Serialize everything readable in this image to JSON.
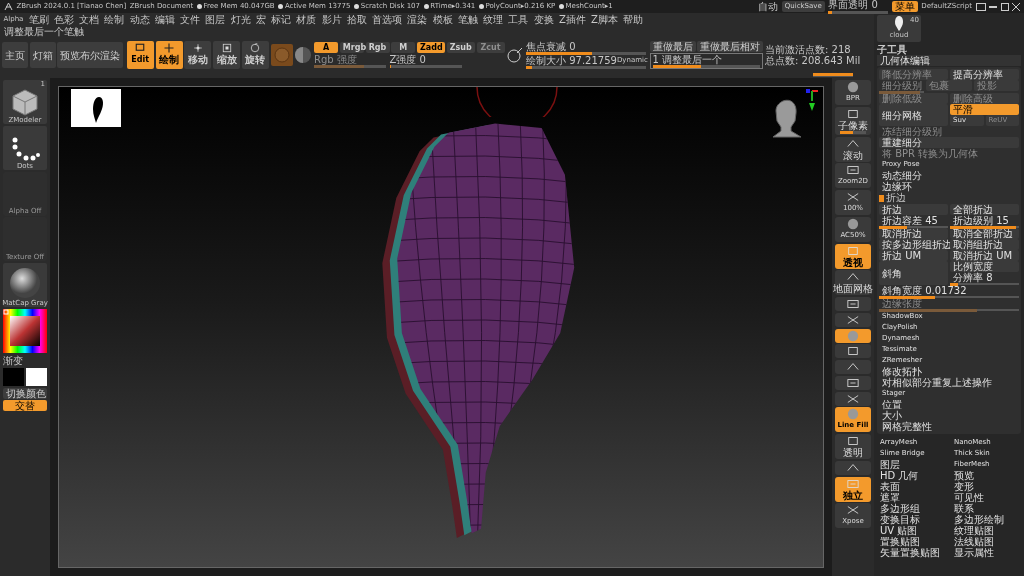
{
  "title_bar": {
    "app": "ZBrush 2024.0.1 [Tianao Chen]",
    "document": "ZBrush Document",
    "stats": [
      "Free Mem 40.047GB",
      "Active Mem 13775",
      "Scratch Disk 107",
      "RTime▸0.341",
      "PolyCount▸0.216 KP",
      "MeshCount▸1"
    ]
  },
  "top_right": {
    "autosave": "自动",
    "quicksave": "QuickSave",
    "transparency": {
      "label": "界面透明 0",
      "level": 0.06
    },
    "menu_button": "菜单",
    "script": "DefaultZScript"
  },
  "menu": [
    "Alpha",
    "笔刷",
    "色彩",
    "文档",
    "绘制",
    "动态",
    "编辑",
    "文件",
    "图层",
    "灯光",
    "宏",
    "标记",
    "材质",
    "影片",
    "拾取",
    "首选项",
    "渲染",
    "模板",
    "笔触",
    "纹理",
    "工具",
    "变换",
    "Z插件",
    "Z脚本",
    "帮助"
  ],
  "hint": "调整最后一个笔触",
  "toolbar": {
    "buttons": [
      "主页",
      "灯箱",
      "预览布尔渲染"
    ],
    "modes": [
      {
        "label": "Edit",
        "selected": true
      },
      {
        "label": "绘制",
        "selected": true
      },
      {
        "label": "移动",
        "selected": false
      },
      {
        "label": "缩放",
        "selected": false
      },
      {
        "label": "旋转",
        "selected": false
      }
    ],
    "channels": [
      {
        "label": "A",
        "selected": true
      },
      {
        "label": "Mrgb",
        "selected": false
      },
      {
        "label": "Rgb",
        "selected": false
      },
      {
        "label": "M",
        "selected": false
      }
    ],
    "z_modes": [
      {
        "label": "Zadd",
        "selected": true,
        "disabled": false
      },
      {
        "label": "Zsub",
        "selected": false,
        "disabled": false
      },
      {
        "label": "Zcut",
        "selected": false,
        "disabled": true
      }
    ],
    "intensity": [
      {
        "label": "Rgb 强度",
        "level": 0.7,
        "disabled": true
      },
      {
        "label": "Z强度 0",
        "level": 0.02,
        "disabled": false
      }
    ],
    "brush_sliders": [
      {
        "label": "焦点衰减 0",
        "level": 0.55
      },
      {
        "label": "绘制大小 97.21759",
        "level": 0.05
      }
    ],
    "dynamic": "Dynamic",
    "redo": [
      "重做最后",
      "重做最后相对"
    ],
    "last_stroke": {
      "value": "1 调整最后一个",
      "level": 0.45
    },
    "active_points": "当前激活点数: 218",
    "total_points": "总点数: 208.643 Mil"
  },
  "left_shelf": [
    {
      "kind": "tool",
      "label": "ZModeler",
      "badge": "1"
    },
    {
      "kind": "brush",
      "label": "Dots"
    },
    {
      "kind": "empty",
      "label": "Alpha Off"
    },
    {
      "kind": "empty",
      "label": "Texture Off"
    },
    {
      "kind": "material",
      "label": "MatCap Gray"
    }
  ],
  "color": {
    "gradient": "渐变",
    "switch": "切换颜色",
    "alternate": "交替"
  },
  "right_shelf": [
    {
      "label": "BPR",
      "selected": false
    },
    {
      "label": "子像素",
      "selected": false,
      "level": 0.5
    },
    {
      "label": "滚动",
      "selected": false
    },
    {
      "label": "Zoom2D",
      "selected": false
    },
    {
      "label": "100%",
      "selected": false
    },
    {
      "label": "AC50%",
      "selected": false
    },
    {
      "label": "透视",
      "selected": true
    },
    {
      "label": "地面网格",
      "selected": false
    },
    {
      "selected": false
    },
    {
      "selected": false
    },
    {
      "selected": true
    },
    {
      "selected": false
    },
    {
      "selected": false
    },
    {
      "selected": false
    },
    {
      "selected": false
    },
    {
      "label": "Line Fill",
      "selected": true
    },
    {
      "label": "透明",
      "selected": false
    },
    {
      "selected": false
    },
    {
      "label": "独立",
      "selected": true
    },
    {
      "label": "Xpose",
      "selected": false
    }
  ],
  "tool_panel": {
    "thumb": {
      "label": "cloud",
      "count": "40"
    },
    "subtool": "子工具",
    "section": "几何体编辑",
    "rows": [
      {
        "cells": [
          {
            "kind": "button",
            "label": "降低分辨率",
            "disabled": true
          },
          {
            "kind": "button",
            "label": "提高分辨率",
            "disabled": false
          }
        ]
      },
      {
        "cells": [
          {
            "kind": "slider",
            "label": "细分级别",
            "level": 0.9,
            "disabled": true
          },
          {
            "kind": "button",
            "label": "包裹",
            "disabled": true
          },
          {
            "kind": "button",
            "label": "投影",
            "disabled": true
          }
        ]
      },
      {
        "cells": [
          {
            "kind": "button",
            "label": "删除低级",
            "disabled": true
          },
          {
            "kind": "button",
            "label": "删除高级",
            "disabled": true
          }
        ]
      },
      {
        "cells": [
          {
            "kind": "button",
            "label": "细分网格",
            "disabled": false
          },
          {
            "kind": "group",
            "rows": [
              {
                "cells": [
                  {
                    "kind": "toggle",
                    "label": "平滑",
                    "on": true,
                    "disabled": false
                  }
                ]
              },
              {
                "cells": [
                  {
                    "kind": "toggle",
                    "label": "Suv",
                    "on": false,
                    "disabled": false
                  },
                  {
                    "kind": "toggle",
                    "label": "ReUV",
                    "on": false,
                    "disabled": true
                  }
                ]
              }
            ]
          }
        ]
      },
      {
        "cells": [
          {
            "kind": "text",
            "label": "冻结细分级别",
            "disabled": true
          }
        ]
      },
      {
        "cells": [
          {
            "kind": "button",
            "label": "重建细分",
            "disabled": false
          }
        ]
      },
      {
        "cells": [
          {
            "kind": "text",
            "label": "将 BPR 转换为几何体",
            "disabled": true
          }
        ]
      },
      {
        "cells": [
          {
            "kind": "text",
            "label": "Proxy Pose",
            "disabled": false
          }
        ]
      },
      {
        "cells": [
          {
            "kind": "text",
            "label": "动态细分",
            "disabled": false
          }
        ]
      },
      {
        "cells": [
          {
            "kind": "text",
            "label": "边缘环",
            "disabled": false
          }
        ]
      },
      {
        "cells": [
          {
            "kind": "section",
            "label": "折边",
            "expanded": true
          }
        ]
      },
      {
        "cells": [
          {
            "kind": "button",
            "label": "折边",
            "disabled": false
          },
          {
            "kind": "button",
            "label": "全部折边",
            "disabled": false
          }
        ]
      },
      {
        "cells": [
          {
            "kind": "slider",
            "label": "折边容差 45",
            "level": 0.4,
            "disabled": false
          },
          {
            "kind": "slider",
            "label": "折边级别 15",
            "level": 0.95,
            "disabled": false
          }
        ]
      },
      {
        "cells": [
          {
            "kind": "button",
            "label": "取消折边",
            "disabled": false
          },
          {
            "kind": "button",
            "label": "取消全部折边",
            "disabled": false
          }
        ]
      },
      {
        "cells": [
          {
            "kind": "button",
            "label": "按多边形组折边",
            "disabled": false
          },
          {
            "kind": "button",
            "label": "取消组折边",
            "disabled": false
          }
        ]
      },
      {
        "cells": [
          {
            "kind": "button",
            "label": "折边 UM",
            "disabled": false
          },
          {
            "kind": "button",
            "label": "取消折边 UM",
            "disabled": false
          }
        ]
      },
      {
        "cells": [
          {
            "kind": "button",
            "label": "斜角",
            "disabled": false
          },
          {
            "kind": "group",
            "rows": [
              {
                "cells": [
                  {
                    "kind": "button",
                    "label": "比例宽度",
                    "disabled": false
                  }
                ]
              },
              {
                "cells": [
                  {
                    "kind": "slider",
                    "label": "分辨率 8",
                    "level": 0.12,
                    "disabled": false
                  }
                ]
              }
            ]
          }
        ]
      },
      {
        "cells": [
          {
            "kind": "slider",
            "label": "斜角宽度 0.01732",
            "level": 0.4,
            "disabled": false
          }
        ]
      },
      {
        "cells": [
          {
            "kind": "slider",
            "label": "边缘张度",
            "level": 0.7,
            "disabled": true
          }
        ]
      },
      {
        "cells": [
          {
            "kind": "text",
            "label": "ShadowBox",
            "disabled": false
          }
        ]
      },
      {
        "cells": [
          {
            "kind": "text",
            "label": "ClayPolish",
            "disabled": false
          }
        ]
      },
      {
        "cells": [
          {
            "kind": "text",
            "label": "Dynamesh",
            "disabled": false
          }
        ]
      },
      {
        "cells": [
          {
            "kind": "text",
            "label": "Tessimate",
            "disabled": false
          }
        ]
      },
      {
        "cells": [
          {
            "kind": "text",
            "label": "ZRemesher",
            "disabled": false
          }
        ]
      },
      {
        "cells": [
          {
            "kind": "text",
            "label": "修改拓扑",
            "disabled": false
          }
        ]
      },
      {
        "cells": [
          {
            "kind": "text",
            "label": "对相似部分重复上述操作",
            "disabled": false
          }
        ]
      },
      {
        "cells": [
          {
            "kind": "text",
            "label": "Stager",
            "disabled": false
          }
        ]
      },
      {
        "cells": [
          {
            "kind": "text",
            "label": "位置",
            "disabled": false
          }
        ]
      },
      {
        "cells": [
          {
            "kind": "text",
            "label": "大小",
            "disabled": false
          }
        ]
      },
      {
        "cells": [
          {
            "kind": "text",
            "label": "网格完整性",
            "disabled": false
          }
        ]
      }
    ],
    "more": [
      "ArrayMesh",
      "NanoMesh",
      "Slime Bridge",
      "Thick Skin",
      "图层",
      "FiberMesh",
      "HD 几何",
      "预览",
      "表面",
      "变形",
      "遮罩",
      "可见性",
      "多边形组",
      "联系",
      "变换目标",
      "多边形绘制",
      "UV 贴图",
      "纹理贴图",
      "置换贴图",
      "法线贴图",
      "矢量置换贴图",
      "显示属性"
    ]
  }
}
